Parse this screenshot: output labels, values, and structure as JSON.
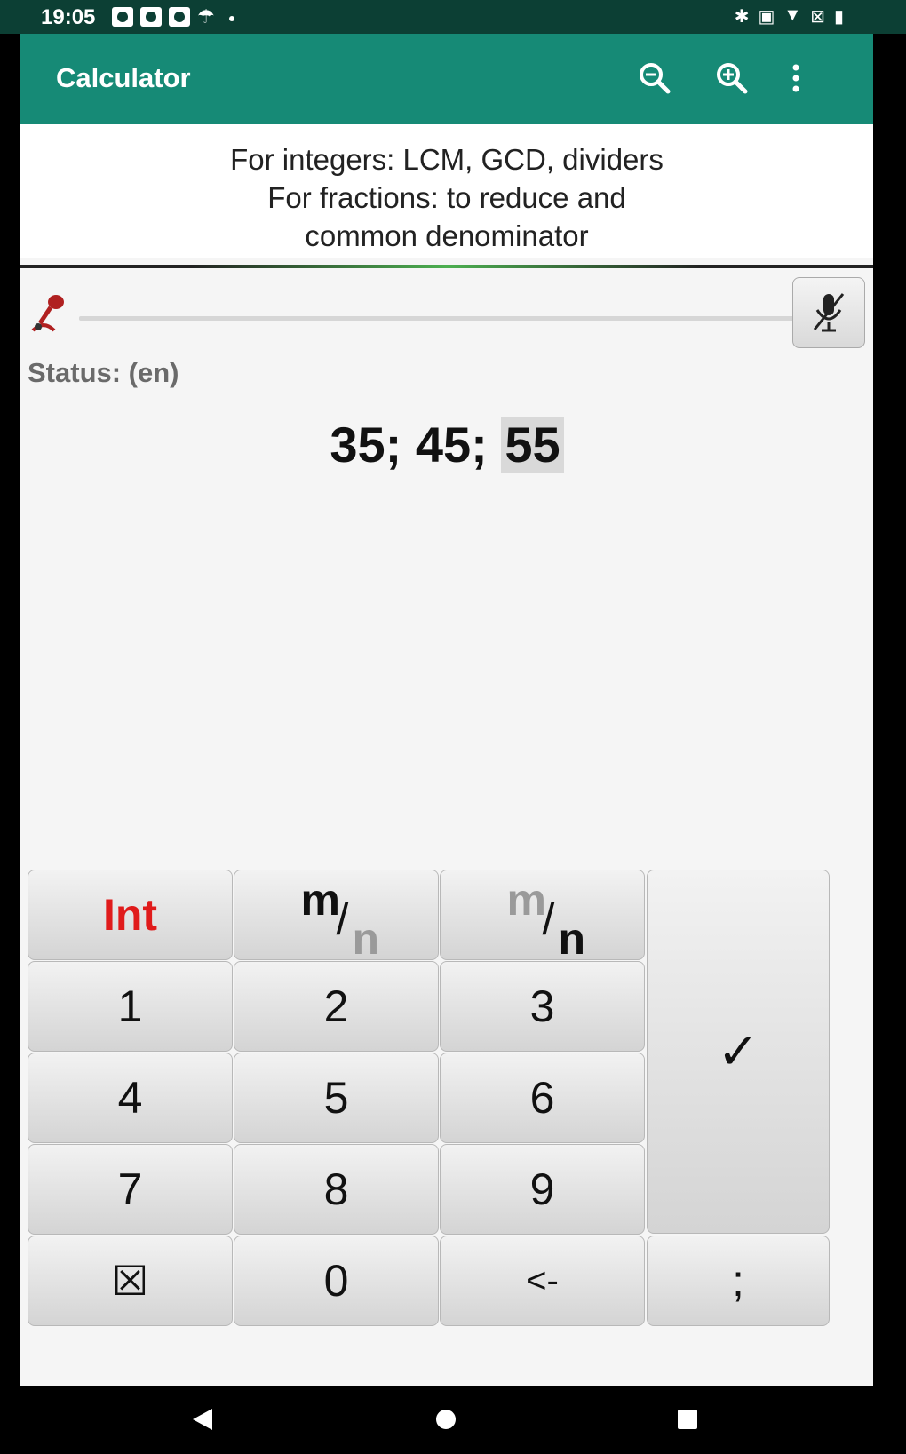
{
  "status_bar": {
    "time": "19:05"
  },
  "app_bar": {
    "title": "Calculator",
    "zoom_out_icon": "zoom-out-icon",
    "zoom_in_icon": "zoom-in-icon",
    "overflow_icon": "more-vert-icon"
  },
  "info": {
    "line1": "For integers: LCM, GCD, dividers",
    "line2": "For fractions: to reduce and",
    "line3": "common denominator"
  },
  "voice": {
    "status": "Status: (en)"
  },
  "expression": {
    "part1": "35",
    "sep1": ";",
    "part2": "45",
    "sep2": ";",
    "part3": "55"
  },
  "keypad": {
    "int_label": "Int",
    "frac_m": "m",
    "frac_slash": "/",
    "frac_n": "n",
    "k1": "1",
    "k2": "2",
    "k3": "3",
    "k4": "4",
    "k5": "5",
    "k6": "6",
    "k7": "7",
    "k8": "8",
    "k9": "9",
    "k0": "0",
    "clear": "☒",
    "backspace": "<-",
    "separator": ";",
    "confirm": "✓"
  },
  "colors": {
    "app_bar": "#168a76",
    "status_bar": "#0c3f34",
    "int_key_text": "#e01b1b",
    "dim_text": "#9a9a9a"
  }
}
